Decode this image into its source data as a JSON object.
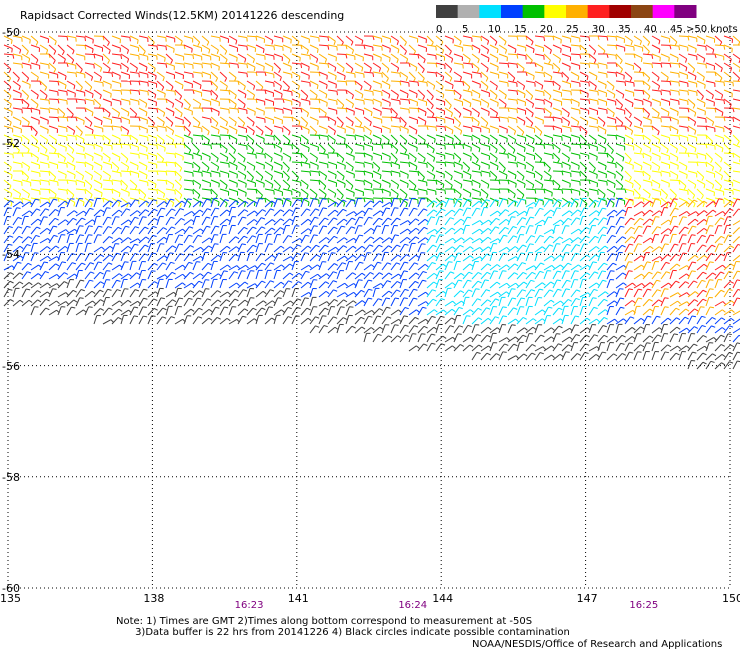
{
  "title": "Rapidsact Corrected Winds(12.5KM) 20141226 descending",
  "colorbar": {
    "labels": [
      "0",
      "5",
      "10",
      "15",
      "20",
      "25",
      "30",
      "35",
      "40",
      "45",
      ">50 knots"
    ],
    "colors": [
      "#404040",
      "#b0b0b0",
      "#00e0ff",
      "#0040ff",
      "#00c000",
      "#ffff00",
      "#ffb000",
      "#ff2020",
      "#a00000",
      "#8b4513",
      "#ff00ff",
      "#800080"
    ]
  },
  "map": {
    "lat_labels": [
      "-50",
      "-52",
      "-54",
      "-56",
      "-58",
      "-60"
    ],
    "lon_labels": [
      "135",
      "138",
      "141",
      "144",
      "147",
      "150"
    ],
    "lat_range": [
      -60,
      -50
    ],
    "lon_range": [
      135,
      150
    ],
    "grid": "dotted"
  },
  "times": [
    {
      "label": "16:23",
      "lon": 140
    },
    {
      "label": "16:24",
      "lon": 143.4
    },
    {
      "label": "16:25",
      "lon": 148.2
    }
  ],
  "notes": {
    "line1": "Note: 1) Times are GMT 2)Times along bottom correspond to measurement at -50S",
    "line2": "      3)Data buffer is 22 hrs from 20141226 4) Black circles indicate possible contamination"
  },
  "credit": "NOAA/NESDIS/Office of Research and Applications"
}
